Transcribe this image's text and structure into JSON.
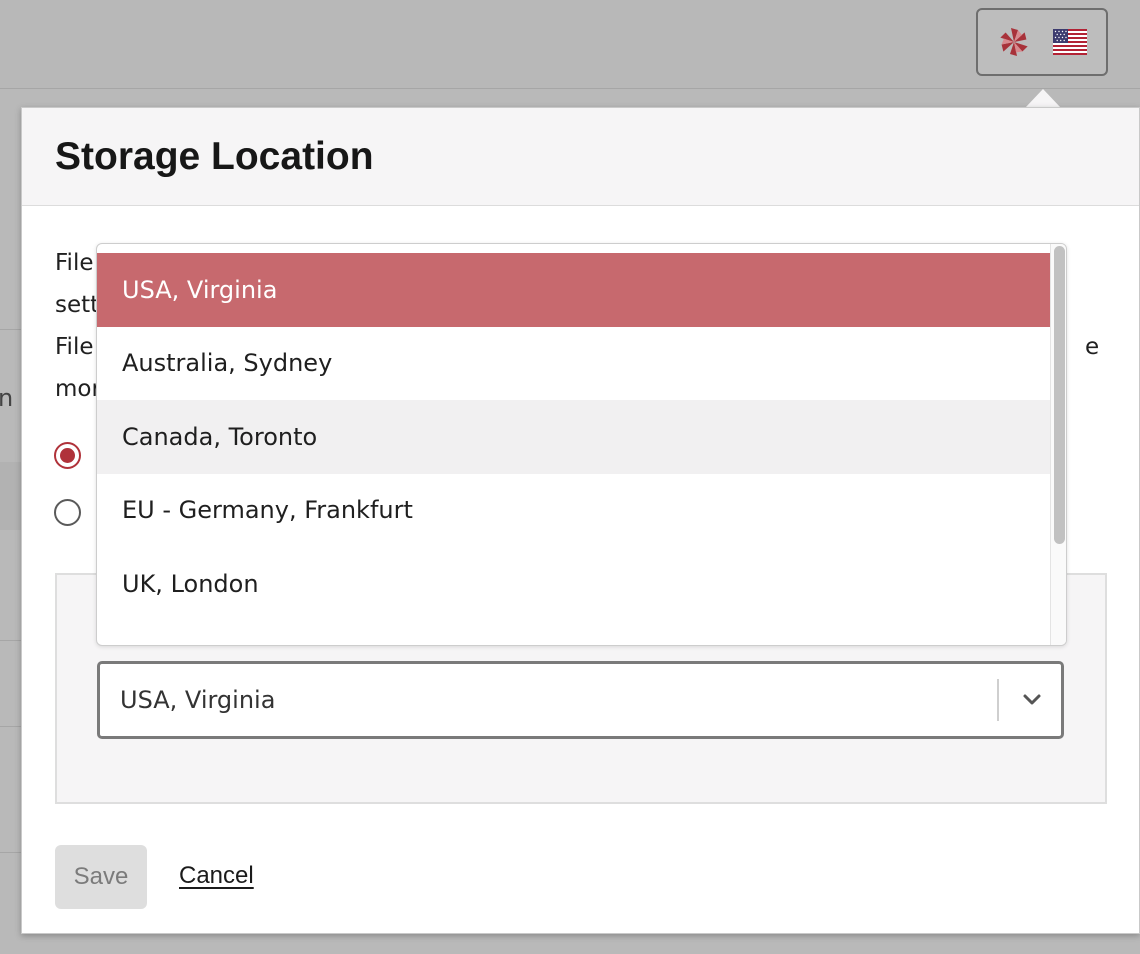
{
  "background": {
    "partial_text": "n"
  },
  "header": {
    "region_button": {
      "logo_icon": "pinwheel-logo-icon",
      "flag_icon": "us-flag-icon"
    }
  },
  "dialog": {
    "title": "Storage Location",
    "description_lines": [
      "File",
      "sett",
      "File",
      "mor"
    ],
    "description_tail": "e",
    "options": [
      {
        "selected": true
      },
      {
        "selected": false
      }
    ],
    "region_select": {
      "value": "USA, Virginia",
      "icon": "chevron-down-icon"
    },
    "dropdown": {
      "items": [
        "USA, Virginia",
        "Australia, Sydney",
        "Canada, Toronto",
        "EU - Germany, Frankfurt",
        "UK, London"
      ],
      "selected_index": 0,
      "hover_index": 2
    },
    "actions": {
      "save_label": "Save",
      "cancel_label": "Cancel"
    }
  },
  "colors": {
    "accent": "#b0323a",
    "selected_option_bg": "#c7696e",
    "overlay": "#b9b9b9"
  }
}
